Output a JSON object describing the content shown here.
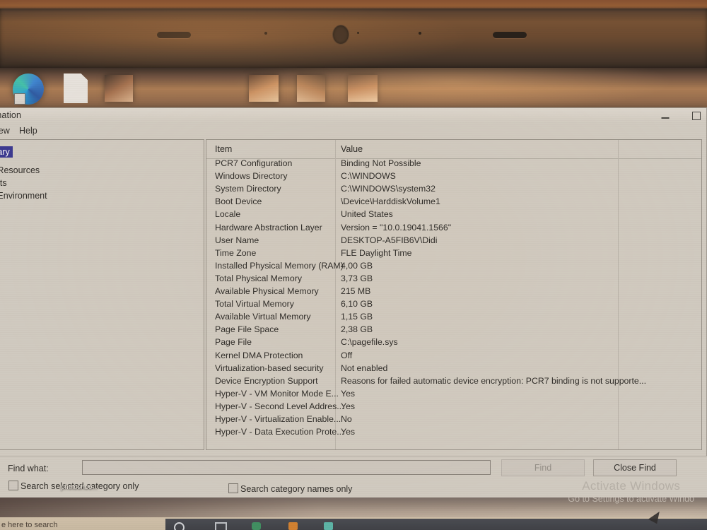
{
  "window": {
    "title_visible": "formation",
    "title_full": "System Information",
    "minimize_icon": "minimize-icon",
    "maximize_icon": "maximize-icon"
  },
  "menu": {
    "items": [
      {
        "visible": "iew",
        "full": "View"
      },
      {
        "visible": "Help",
        "full": "Help"
      }
    ]
  },
  "tree": {
    "nodes": [
      {
        "visible": "mary",
        "full": "System Summary",
        "selected": true
      },
      {
        "visible": "e Resources",
        "full": "Hardware Resources",
        "selected": false
      },
      {
        "visible": "ents",
        "full": "Components",
        "selected": false
      },
      {
        "visible": "e Environment",
        "full": "Software Environment",
        "selected": false
      }
    ]
  },
  "list": {
    "headers": [
      "Item",
      "Value"
    ],
    "rows": [
      {
        "item": "PCR7 Configuration",
        "value": "Binding Not Possible"
      },
      {
        "item": "Windows Directory",
        "value": "C:\\WINDOWS"
      },
      {
        "item": "System Directory",
        "value": "C:\\WINDOWS\\system32"
      },
      {
        "item": "Boot Device",
        "value": "\\Device\\HarddiskVolume1"
      },
      {
        "item": "Locale",
        "value": "United States"
      },
      {
        "item": "Hardware Abstraction Layer",
        "value": "Version = \"10.0.19041.1566\""
      },
      {
        "item": "User Name",
        "value": "DESKTOP-A5FIB6V\\Didi"
      },
      {
        "item": "Time Zone",
        "value": "FLE Daylight Time"
      },
      {
        "item": "Installed Physical Memory (RAM)",
        "value": "4,00 GB"
      },
      {
        "item": "Total Physical Memory",
        "value": "3,73 GB"
      },
      {
        "item": "Available Physical Memory",
        "value": "215 MB"
      },
      {
        "item": "Total Virtual Memory",
        "value": "6,10 GB"
      },
      {
        "item": "Available Virtual Memory",
        "value": "1,15 GB"
      },
      {
        "item": "Page File Space",
        "value": "2,38 GB"
      },
      {
        "item": "Page File",
        "value": "C:\\pagefile.sys"
      },
      {
        "item": "Kernel DMA Protection",
        "value": "Off"
      },
      {
        "item": "Virtualization-based security",
        "value": "Not enabled"
      },
      {
        "item": "Device Encryption Support",
        "value": "Reasons for failed automatic device encryption: PCR7 binding is not supporte..."
      },
      {
        "item": "Hyper-V - VM Monitor Mode E...",
        "value": "Yes"
      },
      {
        "item": "Hyper-V - Second Level Addres...",
        "value": "Yes"
      },
      {
        "item": "Hyper-V - Virtualization Enable...",
        "value": "No"
      },
      {
        "item": "Hyper-V - Data Execution Prote...",
        "value": "Yes"
      }
    ]
  },
  "find": {
    "label": "Find what:",
    "input_value": "",
    "input_placeholder": "",
    "checkbox_selected_category": "Search selected category only",
    "checkbox_category_names": "Search category names only",
    "find_button": "Find",
    "close_button": "Close Find"
  },
  "desktop": {
    "icon_label": "photoshoo...",
    "icons": [
      "edge-browser-icon",
      "document-icon",
      "photo-thumbnail-icon",
      "photo-thumbnail-icon",
      "photo-thumbnail-icon",
      "photo-thumbnail-icon"
    ]
  },
  "watermark": {
    "line1": "Activate Windows",
    "line2": "Go to Settings to activate Windo"
  },
  "taskbar": {
    "search_visible": "e here to search",
    "search_full": "Type here to search",
    "icons": [
      "cortana-icon",
      "task-view-icon",
      "app-green-icon",
      "app-orange-icon",
      "app-teal-icon"
    ]
  },
  "colors": {
    "window_bg": "#cfcbc3",
    "selection": "#2b2b8e",
    "text": "#1b1b1a"
  }
}
